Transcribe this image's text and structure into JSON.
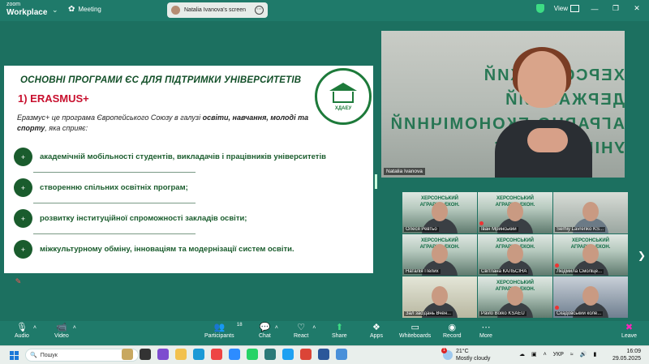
{
  "titlebar": {
    "logo_top": "zoom",
    "logo_bottom": "Workplace",
    "meeting_label": "Meeting",
    "screen_pill": "Natalia Ivanova's screen",
    "view_label": "View"
  },
  "slide": {
    "title": "ОСНОВНІ ПРОГРАМИ ЄС ДЛЯ ПІДТРИМКИ УНІВЕРСИТЕТІВ",
    "subtitle": "1) ERASMUS+",
    "intro_start": "Еразмус+ це програма Європейського Союзу в галузі ",
    "intro_bold": "освіти, навчання, молоді та спорту",
    "intro_end": ", яка сприяє:",
    "emblem_text": "ХДАЕУ",
    "bullets": [
      "академічній мобільності студентів, викладачів і працівників університетів",
      "створенню спільних освітніх програм;",
      "розвитку інституційної спроможності закладів освіти;",
      "міжкультурному обміну, інноваціям та модернізації систем освіти."
    ],
    "bullet_symbol": "+"
  },
  "speaker": {
    "name": "Natalia Ivanova",
    "wall_text_line1": "ХЕРСОНСЬКИЙ ДЕРЖАВНИЙ",
    "wall_text_line2": "АГРАРНО-ЕКОНОМІЧНИЙ",
    "wall_text_line3": "УНІВЕРСИТЕТ"
  },
  "gallery": [
    {
      "name": "Олеся Ревтьо",
      "muted": false
    },
    {
      "name": "Іван Мринський",
      "muted": true
    },
    {
      "name": "Serhiy Lavrenko KS...",
      "muted": false
    },
    {
      "name": "Наталія Пелих",
      "muted": false
    },
    {
      "name": "Світлана КАЛЬСІНА",
      "muted": false
    },
    {
      "name": "Людмила Смоліце...",
      "muted": true
    },
    {
      "name": "Зал засідань Вчен...",
      "muted": false
    },
    {
      "name": "Pavlo Boiko KSAEU",
      "muted": false
    },
    {
      "name": "Скадовський коле...",
      "muted": true
    }
  ],
  "toolbar": {
    "audio": "Audio",
    "video": "Video",
    "participants": "Participants",
    "participants_count": "18",
    "chat": "Chat",
    "react": "React",
    "share": "Share",
    "apps": "Apps",
    "whiteboards": "Whiteboards",
    "record": "Record",
    "more": "More",
    "leave": "Leave"
  },
  "taskbar": {
    "search_placeholder": "Пошук",
    "weather_temp": "21°C",
    "weather_desc": "Mostly cloudy",
    "weather_badge": "1",
    "lang": "УКР",
    "time": "16:09",
    "date": "29.05.2025"
  }
}
